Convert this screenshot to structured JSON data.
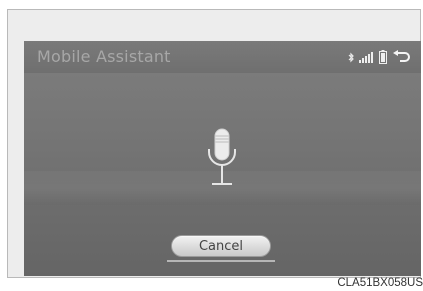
{
  "screen": {
    "title": "Mobile Assistant",
    "status_icons": [
      "bluetooth-icon",
      "signal-strength-icon",
      "battery-icon",
      "back-icon"
    ],
    "cancel_label": "Cancel"
  },
  "caption": "CLA51BX058US"
}
